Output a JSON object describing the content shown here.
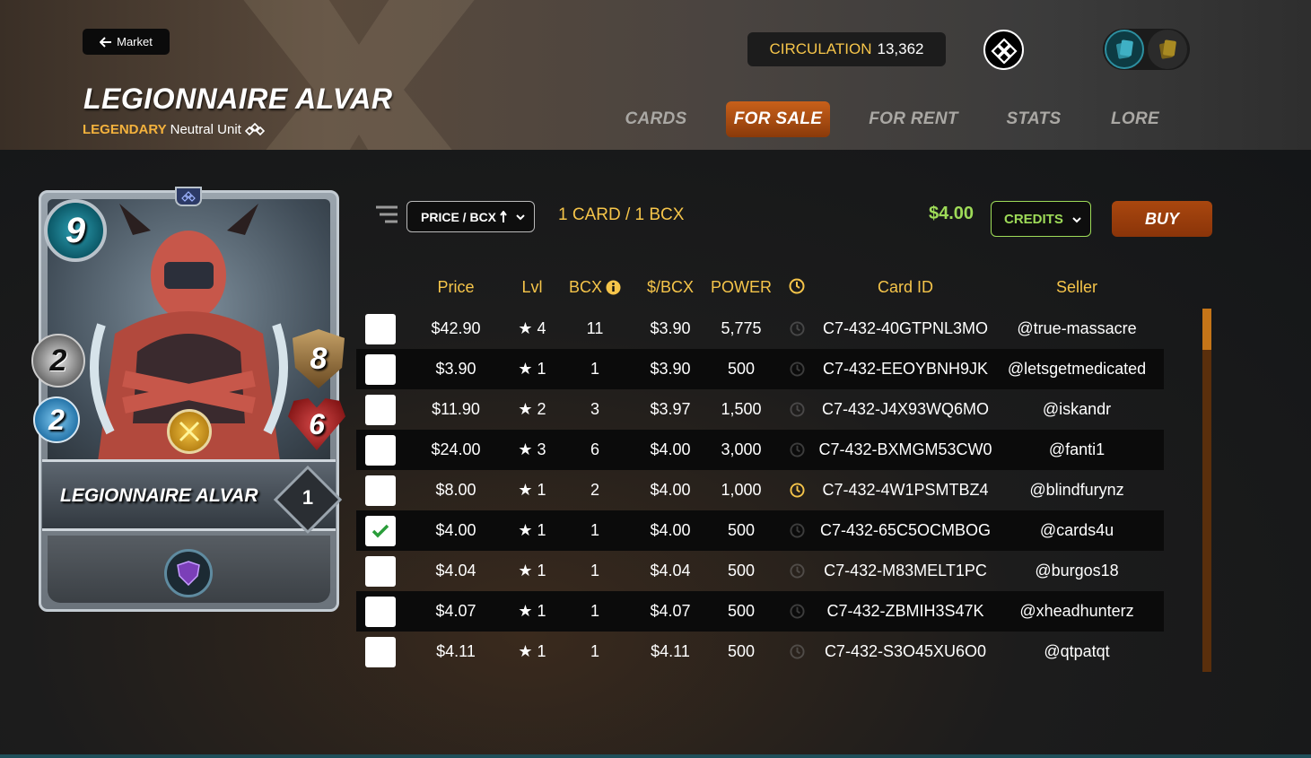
{
  "header": {
    "back_label": "Market",
    "card_name": "LEGIONNAIRE ALVAR",
    "rarity": "LEGENDARY",
    "type_text": "Neutral Unit",
    "circulation_label": "CIRCULATION",
    "circulation_value": "13,362",
    "tabs": [
      "CARDS",
      "FOR SALE",
      "FOR RENT",
      "STATS",
      "LORE"
    ],
    "active_tab": "FOR SALE"
  },
  "card": {
    "name": "LEGIONNAIRE ALVAR",
    "mana": "9",
    "melee": "2",
    "speed": "2",
    "armor": "8",
    "health": "6",
    "level": "1"
  },
  "toolbar": {
    "sort_label": "PRICE / BCX",
    "selection_summary": "1 CARD / 1 BCX",
    "total_price": "$4.00",
    "currency": "CREDITS",
    "buy_label": "BUY"
  },
  "table": {
    "headers": [
      "Price",
      "Lvl",
      "BCX",
      "$/BCX",
      "POWER",
      "Card ID",
      "Seller"
    ],
    "rows": [
      {
        "price": "$42.90",
        "lvl": "★ 4",
        "bcx": "11",
        "per_bcx": "$3.90",
        "power": "5,775",
        "clock": "dim",
        "id": "C7-432-40GTPNL3MO",
        "seller": "@true-massacre",
        "checked": false
      },
      {
        "price": "$3.90",
        "lvl": "★ 1",
        "bcx": "1",
        "per_bcx": "$3.90",
        "power": "500",
        "clock": "dim",
        "id": "C7-432-EEOYBNH9JK",
        "seller": "@letsgetmedicated",
        "checked": false
      },
      {
        "price": "$11.90",
        "lvl": "★ 2",
        "bcx": "3",
        "per_bcx": "$3.97",
        "power": "1,500",
        "clock": "dim",
        "id": "C7-432-J4X93WQ6MO",
        "seller": "@iskandr",
        "checked": false
      },
      {
        "price": "$24.00",
        "lvl": "★ 3",
        "bcx": "6",
        "per_bcx": "$4.00",
        "power": "3,000",
        "clock": "dim",
        "id": "C7-432-BXMGM53CW0",
        "seller": "@fanti1",
        "checked": false
      },
      {
        "price": "$8.00",
        "lvl": "★ 1",
        "bcx": "2",
        "per_bcx": "$4.00",
        "power": "1,000",
        "clock": "active",
        "id": "C7-432-4W1PSMTBZ4",
        "seller": "@blindfurynz",
        "checked": false
      },
      {
        "price": "$4.00",
        "lvl": "★ 1",
        "bcx": "1",
        "per_bcx": "$4.00",
        "power": "500",
        "clock": "dim",
        "id": "C7-432-65C5OCMBOG",
        "seller": "@cards4u",
        "checked": true
      },
      {
        "price": "$4.04",
        "lvl": "★ 1",
        "bcx": "1",
        "per_bcx": "$4.04",
        "power": "500",
        "clock": "dim",
        "id": "C7-432-M83MELT1PC",
        "seller": "@burgos18",
        "checked": false
      },
      {
        "price": "$4.07",
        "lvl": "★ 1",
        "bcx": "1",
        "per_bcx": "$4.07",
        "power": "500",
        "clock": "dim",
        "id": "C7-432-ZBMIH3S47K",
        "seller": "@xheadhunterz",
        "checked": false
      },
      {
        "price": "$4.11",
        "lvl": "★ 1",
        "bcx": "1",
        "per_bcx": "$4.11",
        "power": "500",
        "clock": "dim",
        "id": "C7-432-S3O45XU6O0",
        "seller": "@qtpatqt",
        "checked": false
      }
    ]
  },
  "colors": {
    "accent_gold": "#f6c54a",
    "active_tab": "#a9470f",
    "price_green": "#9edb58",
    "check_green": "#2a9d3a"
  },
  "icons": [
    "back-arrow-icon",
    "edition-icon",
    "card-view-icon",
    "gold-card-icon",
    "filter-icon",
    "chevron-down-icon",
    "info-icon",
    "clock-icon",
    "check-icon"
  ]
}
